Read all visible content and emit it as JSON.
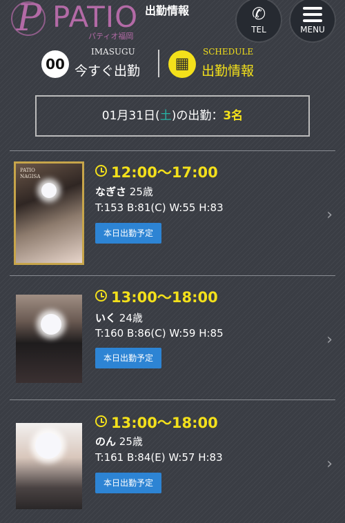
{
  "header": {
    "logo_monogram": "P",
    "logo_text": "PATIO",
    "logo_sub": "パティオ福岡",
    "page_title": "出勤情報",
    "tel_label": "TEL",
    "menu_label": "MENU"
  },
  "nav": {
    "imasugu": {
      "badge": "00",
      "small": "IMASUGU",
      "label": "今すぐ出勤"
    },
    "schedule": {
      "small": "SCHEDULE",
      "label": "出勤情報"
    }
  },
  "summary": {
    "date_prefix": "01月31日(",
    "dow": "土",
    "date_suffix": ")の出勤：",
    "count": "3名"
  },
  "entries": [
    {
      "time": "12:00〜17:00",
      "name": "なぎさ",
      "age": "25歳",
      "stats": "T:153 B:81(C) W:55 H:83",
      "status": "本日出勤予定",
      "photo_label": "PATIO\nNAGISA"
    },
    {
      "time": "13:00〜18:00",
      "name": "いく",
      "age": "24歳",
      "stats": "T:160 B:86(C) W:59 H:85",
      "status": "本日出勤予定"
    },
    {
      "time": "13:00〜18:00",
      "name": "のん",
      "age": "25歳",
      "stats": "T:161 B:84(E) W:57 H:83",
      "status": "本日出勤予定"
    }
  ],
  "colors": {
    "accent_yellow": "#f3e01b",
    "brand_purple": "#b36aa6",
    "status_blue": "#2d84d4",
    "dow_teal": "#27b5a8"
  },
  "icons": {
    "tel": "phone-icon",
    "menu": "hamburger-icon",
    "schedule": "calendar-icon",
    "time": "clock-icon",
    "entry_arrow": "chevron-right-icon"
  }
}
